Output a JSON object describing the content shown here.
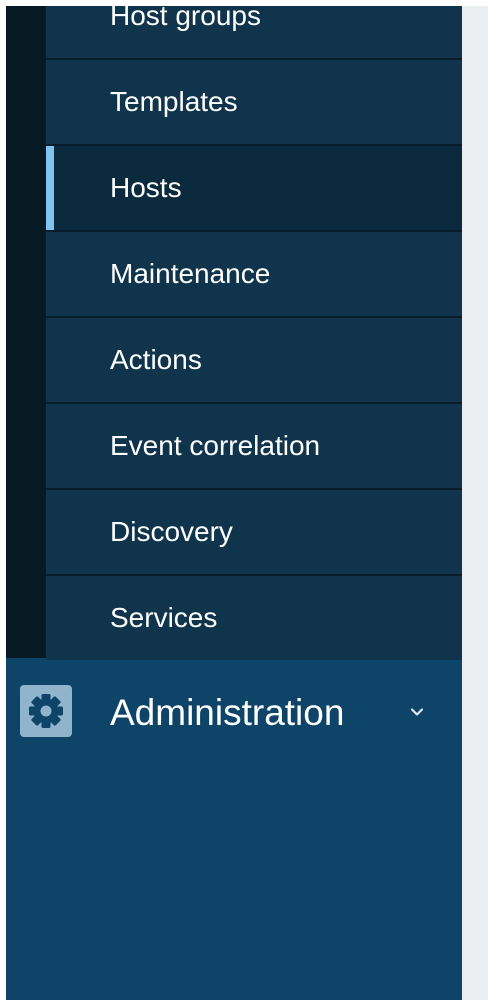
{
  "sidebar": {
    "submenu_items": [
      {
        "label": "Host groups",
        "selected": false
      },
      {
        "label": "Templates",
        "selected": false
      },
      {
        "label": "Hosts",
        "selected": true
      },
      {
        "label": "Maintenance",
        "selected": false
      },
      {
        "label": "Actions",
        "selected": false
      },
      {
        "label": "Event correlation",
        "selected": false
      },
      {
        "label": "Discovery",
        "selected": false
      },
      {
        "label": "Services",
        "selected": false
      }
    ],
    "administration": {
      "label": "Administration",
      "icon": "gear-icon",
      "expand_icon": "chevron-down-icon"
    }
  },
  "colors": {
    "sidebar_bg": "#0e4468",
    "submenu_item_bg": "#0f344c",
    "submenu_selected_bg": "#0b2a3d",
    "selected_indicator": "#7fc4ee",
    "dark_rail": "#071a24",
    "content_bg": "#ebeef0",
    "text": "#ffffff"
  }
}
